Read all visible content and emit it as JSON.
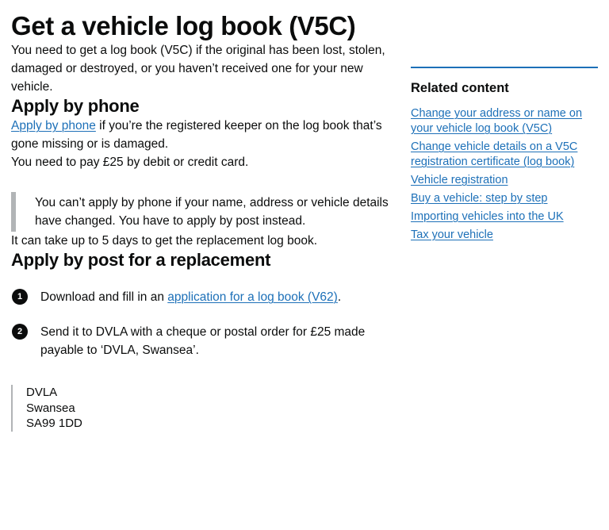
{
  "page": {
    "title": "Get a vehicle log book (V5C)",
    "intro": "You need to get a log book (V5C) if the original has been lost, stolen, damaged or destroyed, or you haven’t received one for your new vehicle."
  },
  "phone_section": {
    "heading": "Apply by phone",
    "lead_link": "Apply by phone",
    "lead_rest": " if you’re the registered keeper on the log book that’s gone missing or is damaged.",
    "fee": "You need to pay £25 by debit or credit card.",
    "inset": "You can’t apply by phone if your name, address or vehicle details have changed. You have to apply by post instead.",
    "timing": "It can take up to 5 days to get the replacement log book."
  },
  "post_section": {
    "heading": "Apply by post for a replacement",
    "steps": [
      {
        "number": "1",
        "text_before": "Download and fill in an ",
        "link": "application for a log book (V62)",
        "text_after": "."
      },
      {
        "number": "2",
        "text_before": "Send it to DVLA with a cheque or postal order for £25 made payable to ‘DVLA, Swansea’.",
        "link": "",
        "text_after": ""
      }
    ],
    "address": {
      "line1": "DVLA",
      "line2": "Swansea",
      "line3": "SA99 1DD"
    }
  },
  "sidebar": {
    "title": "Related content",
    "links": [
      "Change your address or name on your vehicle log book (V5C)",
      "Change vehicle details on a V5C registration certificate (log book)",
      "Vehicle registration",
      "Buy a vehicle: step by step",
      "Importing vehicles into the UK",
      "Tax your vehicle"
    ]
  },
  "colors": {
    "link": "#1d70b8",
    "text": "#0b0c0c",
    "rule": "#1d70b8",
    "inset_border": "#b1b4b6"
  }
}
